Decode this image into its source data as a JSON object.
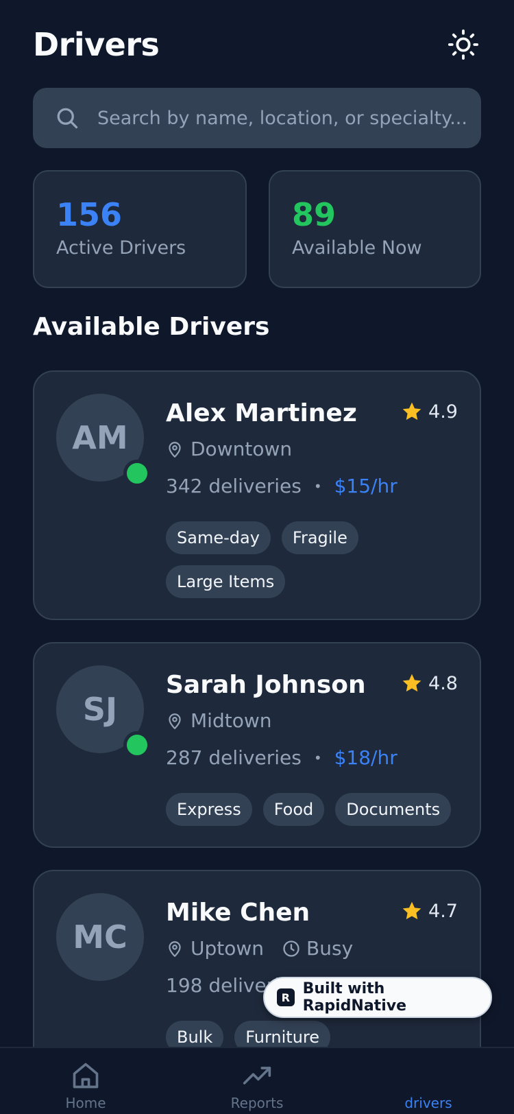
{
  "header": {
    "title": "Drivers",
    "theme_icon": "sun-icon"
  },
  "search": {
    "placeholder": "Search by name, location, or specialty...",
    "value": ""
  },
  "stats": [
    {
      "value": "156",
      "label": "Active Drivers",
      "color": "#3b82f6"
    },
    {
      "value": "89",
      "label": "Available Now",
      "color": "#22c55e"
    }
  ],
  "section_title": "Available Drivers",
  "drivers": [
    {
      "initials": "AM",
      "name": "Alex Martinez",
      "rating": "4.9",
      "location": "Downtown",
      "deliveries": "342 deliveries",
      "rate": "$15/hr",
      "online": true,
      "status": "",
      "tags": [
        "Same-day",
        "Fragile",
        "Large Items"
      ]
    },
    {
      "initials": "SJ",
      "name": "Sarah Johnson",
      "rating": "4.8",
      "location": "Midtown",
      "deliveries": "287 deliveries",
      "rate": "$18/hr",
      "online": true,
      "status": "",
      "tags": [
        "Express",
        "Food",
        "Documents"
      ]
    },
    {
      "initials": "MC",
      "name": "Mike Chen",
      "rating": "4.7",
      "location": "Uptown",
      "deliveries": "198 deliveri",
      "rate": "",
      "online": false,
      "status": "Busy",
      "tags": [
        "Bulk",
        "Furniture"
      ]
    }
  ],
  "badge": {
    "text": "Built with RapidNative",
    "logo": "R"
  },
  "tabs": [
    {
      "label": "Home",
      "icon": "home-icon",
      "active": false
    },
    {
      "label": "Reports",
      "icon": "trending-up-icon",
      "active": false
    },
    {
      "label": "drivers",
      "icon": "",
      "active": true
    }
  ],
  "colors": {
    "background": "#0f172a",
    "card": "#1e293b",
    "accent": "#3b82f6",
    "online": "#22c55e",
    "star": "#fbbf24"
  }
}
